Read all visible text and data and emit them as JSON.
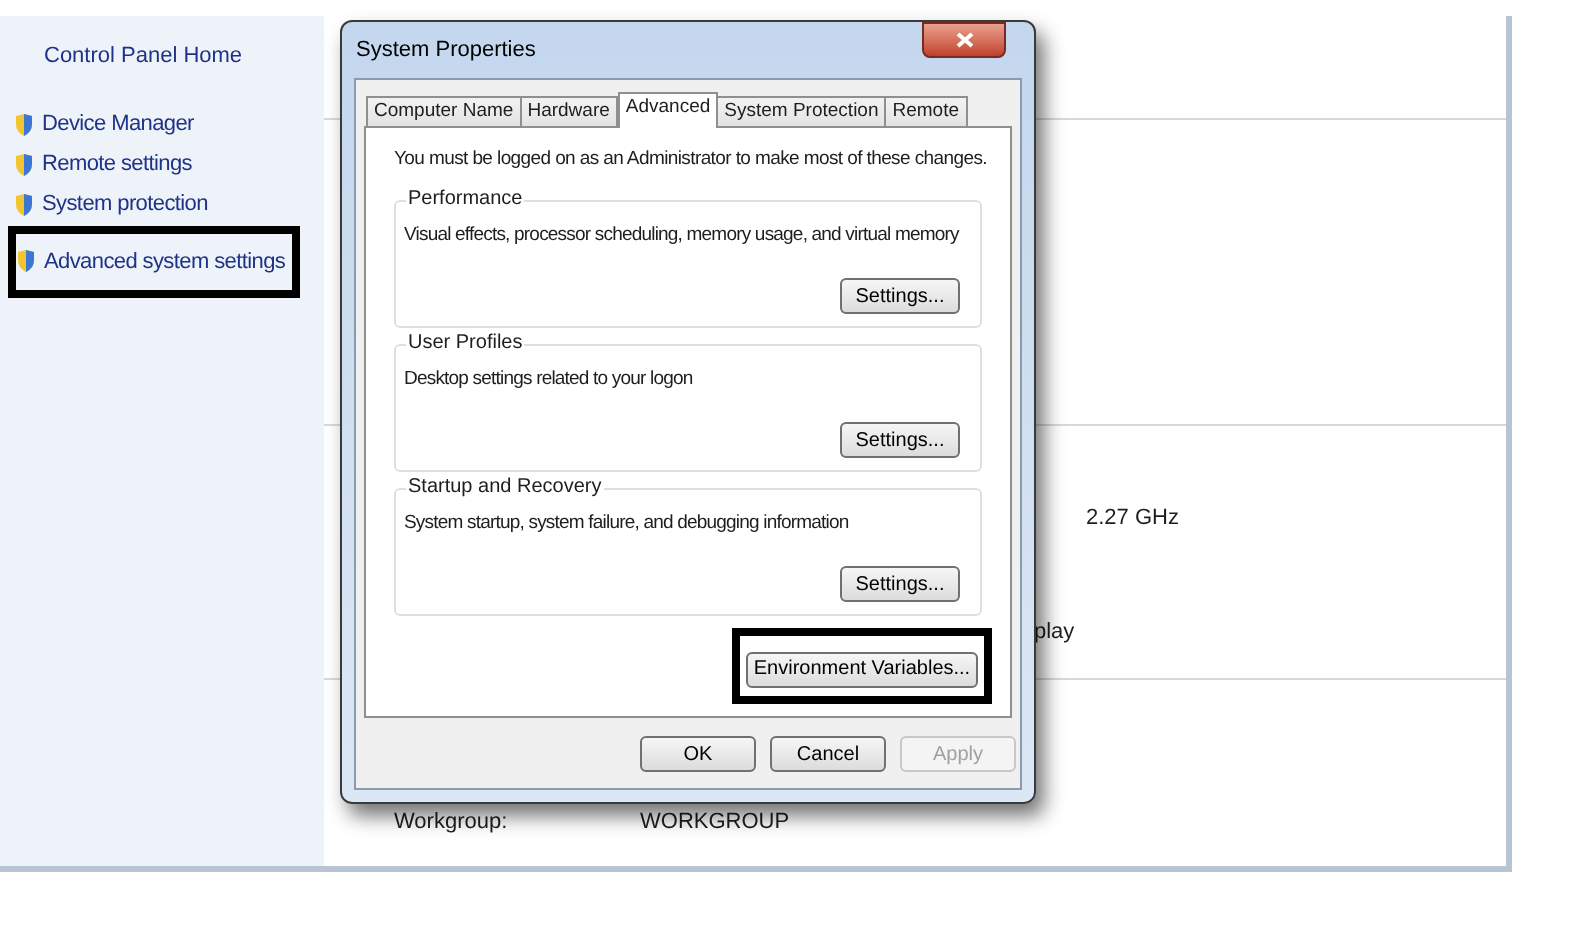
{
  "sidebar": {
    "title": "Control Panel Home",
    "items": [
      {
        "label": "Device Manager",
        "highlighted": false
      },
      {
        "label": "Remote settings",
        "highlighted": false
      },
      {
        "label": "System protection",
        "highlighted": false
      },
      {
        "label": "Advanced system settings",
        "highlighted": true
      }
    ]
  },
  "background": {
    "fragments": [
      "2.27 GHz",
      "play"
    ],
    "workgroup": {
      "label": "Workgroup:",
      "value": "WORKGROUP"
    }
  },
  "dialog": {
    "title": "System Properties",
    "tabs": [
      {
        "label": "Computer Name",
        "selected": false
      },
      {
        "label": "Hardware",
        "selected": false
      },
      {
        "label": "Advanced",
        "selected": true
      },
      {
        "label": "System Protection",
        "selected": false
      },
      {
        "label": "Remote",
        "selected": false
      }
    ],
    "notice": "You must be logged on as an Administrator to make most of these changes.",
    "groups": [
      {
        "title": "Performance",
        "description": "Visual effects, processor scheduling, memory usage, and virtual memory",
        "button": "Settings..."
      },
      {
        "title": "User Profiles",
        "description": "Desktop settings related to your logon",
        "button": "Settings..."
      },
      {
        "title": "Startup and Recovery",
        "description": "System startup, system failure, and debugging information",
        "button": "Settings..."
      }
    ],
    "extra_button": {
      "label": "Environment Variables...",
      "highlighted": true
    },
    "buttons": [
      {
        "label": "OK",
        "disabled": false
      },
      {
        "label": "Cancel",
        "disabled": false
      },
      {
        "label": "Apply",
        "disabled": true
      }
    ]
  }
}
